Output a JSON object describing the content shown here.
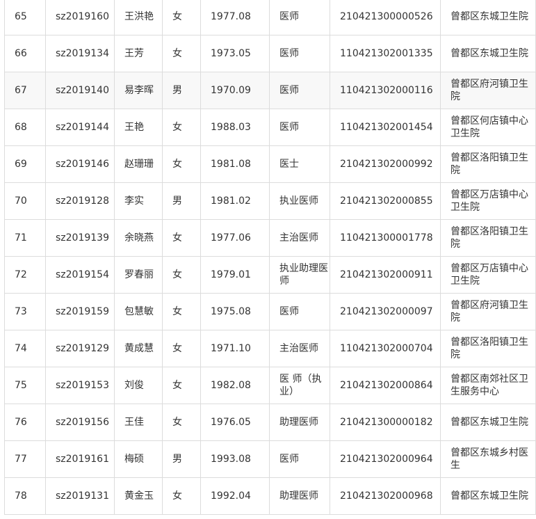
{
  "rows": [
    {
      "no": "65",
      "code": "sz2019160",
      "name": "王洪艳",
      "sex": "女",
      "birth": "1977.08",
      "title": "医师",
      "cert": "210421300000526",
      "unit": "曾都区东城卫生院"
    },
    {
      "no": "66",
      "code": "sz2019134",
      "name": "王芳",
      "sex": "女",
      "birth": "1973.05",
      "title": "医师",
      "cert": "110421302001335",
      "unit": "曾都区东城卫生院"
    },
    {
      "no": "67",
      "code": "sz2019140",
      "name": "易李晖",
      "sex": "男",
      "birth": "1970.09",
      "title": "医师",
      "cert": "110421302000116",
      "unit": "曾都区府河镇卫生院"
    },
    {
      "no": "68",
      "code": "sz2019144",
      "name": "王艳",
      "sex": "女",
      "birth": "1988.03",
      "title": "医师",
      "cert": "110421302001454",
      "unit": "曾都区何店镇中心卫生院"
    },
    {
      "no": "69",
      "code": "sz2019146",
      "name": "赵珊珊",
      "sex": "女",
      "birth": "1981.08",
      "title": "医士",
      "cert": "210421302000992",
      "unit": "曾都区洛阳镇卫生院"
    },
    {
      "no": "70",
      "code": "sz2019128",
      "name": "李实",
      "sex": "男",
      "birth": "1981.02",
      "title": "执业医师",
      "cert": "210421302000855",
      "unit": "曾都区万店镇中心卫生院"
    },
    {
      "no": "71",
      "code": "sz2019139",
      "name": "余晓燕",
      "sex": "女",
      "birth": "1977.06",
      "title": "主治医师",
      "cert": "110421300001778",
      "unit": "曾都区洛阳镇卫生院"
    },
    {
      "no": "72",
      "code": "sz2019154",
      "name": "罗春丽",
      "sex": "女",
      "birth": "1979.01",
      "title": "执业助理医师",
      "cert": "210421302000911",
      "unit": "曾都区万店镇中心卫生院"
    },
    {
      "no": "73",
      "code": "sz2019159",
      "name": "包慧敏",
      "sex": "女",
      "birth": "1975.08",
      "title": "医师",
      "cert": "210421302000097",
      "unit": "曾都区府河镇卫生院"
    },
    {
      "no": "74",
      "code": "sz2019129",
      "name": "黄成慧",
      "sex": "女",
      "birth": "1971.10",
      "title": "主治医师",
      "cert": "110421302000704",
      "unit": "曾都区洛阳镇卫生院"
    },
    {
      "no": "75",
      "code": "sz2019153",
      "name": "刘俊",
      "sex": "女",
      "birth": "1982.08",
      "title": "医 师（执业）",
      "cert": "210421302000864",
      "unit": "曾都区南郊社区卫生服务中心"
    },
    {
      "no": "76",
      "code": "sz2019156",
      "name": "王佳",
      "sex": "女",
      "birth": "1976.05",
      "title": "助理医师",
      "cert": "210421300000182",
      "unit": "曾都区东城卫生院"
    },
    {
      "no": "77",
      "code": "sz2019161",
      "name": "梅硕",
      "sex": "男",
      "birth": "1993.08",
      "title": "医师",
      "cert": "210421302000964",
      "unit": "曾都区东城乡村医生"
    },
    {
      "no": "78",
      "code": "sz2019131",
      "name": "黄金玉",
      "sex": "女",
      "birth": "1992.04",
      "title": "助理医师",
      "cert": "210421302000968",
      "unit": "曾都区东城卫生院"
    }
  ]
}
